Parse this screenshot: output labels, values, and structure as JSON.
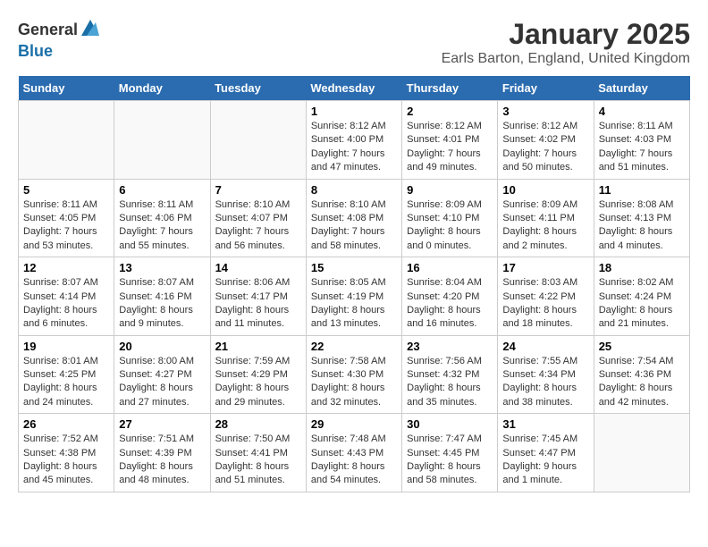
{
  "logo": {
    "general": "General",
    "blue": "Blue"
  },
  "title": "January 2025",
  "subtitle": "Earls Barton, England, United Kingdom",
  "headers": [
    "Sunday",
    "Monday",
    "Tuesday",
    "Wednesday",
    "Thursday",
    "Friday",
    "Saturday"
  ],
  "weeks": [
    [
      {
        "day": "",
        "content": ""
      },
      {
        "day": "",
        "content": ""
      },
      {
        "day": "",
        "content": ""
      },
      {
        "day": "1",
        "content": "Sunrise: 8:12 AM\nSunset: 4:00 PM\nDaylight: 7 hours\nand 47 minutes."
      },
      {
        "day": "2",
        "content": "Sunrise: 8:12 AM\nSunset: 4:01 PM\nDaylight: 7 hours\nand 49 minutes."
      },
      {
        "day": "3",
        "content": "Sunrise: 8:12 AM\nSunset: 4:02 PM\nDaylight: 7 hours\nand 50 minutes."
      },
      {
        "day": "4",
        "content": "Sunrise: 8:11 AM\nSunset: 4:03 PM\nDaylight: 7 hours\nand 51 minutes."
      }
    ],
    [
      {
        "day": "5",
        "content": "Sunrise: 8:11 AM\nSunset: 4:05 PM\nDaylight: 7 hours\nand 53 minutes."
      },
      {
        "day": "6",
        "content": "Sunrise: 8:11 AM\nSunset: 4:06 PM\nDaylight: 7 hours\nand 55 minutes."
      },
      {
        "day": "7",
        "content": "Sunrise: 8:10 AM\nSunset: 4:07 PM\nDaylight: 7 hours\nand 56 minutes."
      },
      {
        "day": "8",
        "content": "Sunrise: 8:10 AM\nSunset: 4:08 PM\nDaylight: 7 hours\nand 58 minutes."
      },
      {
        "day": "9",
        "content": "Sunrise: 8:09 AM\nSunset: 4:10 PM\nDaylight: 8 hours\nand 0 minutes."
      },
      {
        "day": "10",
        "content": "Sunrise: 8:09 AM\nSunset: 4:11 PM\nDaylight: 8 hours\nand 2 minutes."
      },
      {
        "day": "11",
        "content": "Sunrise: 8:08 AM\nSunset: 4:13 PM\nDaylight: 8 hours\nand 4 minutes."
      }
    ],
    [
      {
        "day": "12",
        "content": "Sunrise: 8:07 AM\nSunset: 4:14 PM\nDaylight: 8 hours\nand 6 minutes."
      },
      {
        "day": "13",
        "content": "Sunrise: 8:07 AM\nSunset: 4:16 PM\nDaylight: 8 hours\nand 9 minutes."
      },
      {
        "day": "14",
        "content": "Sunrise: 8:06 AM\nSunset: 4:17 PM\nDaylight: 8 hours\nand 11 minutes."
      },
      {
        "day": "15",
        "content": "Sunrise: 8:05 AM\nSunset: 4:19 PM\nDaylight: 8 hours\nand 13 minutes."
      },
      {
        "day": "16",
        "content": "Sunrise: 8:04 AM\nSunset: 4:20 PM\nDaylight: 8 hours\nand 16 minutes."
      },
      {
        "day": "17",
        "content": "Sunrise: 8:03 AM\nSunset: 4:22 PM\nDaylight: 8 hours\nand 18 minutes."
      },
      {
        "day": "18",
        "content": "Sunrise: 8:02 AM\nSunset: 4:24 PM\nDaylight: 8 hours\nand 21 minutes."
      }
    ],
    [
      {
        "day": "19",
        "content": "Sunrise: 8:01 AM\nSunset: 4:25 PM\nDaylight: 8 hours\nand 24 minutes."
      },
      {
        "day": "20",
        "content": "Sunrise: 8:00 AM\nSunset: 4:27 PM\nDaylight: 8 hours\nand 27 minutes."
      },
      {
        "day": "21",
        "content": "Sunrise: 7:59 AM\nSunset: 4:29 PM\nDaylight: 8 hours\nand 29 minutes."
      },
      {
        "day": "22",
        "content": "Sunrise: 7:58 AM\nSunset: 4:30 PM\nDaylight: 8 hours\nand 32 minutes."
      },
      {
        "day": "23",
        "content": "Sunrise: 7:56 AM\nSunset: 4:32 PM\nDaylight: 8 hours\nand 35 minutes."
      },
      {
        "day": "24",
        "content": "Sunrise: 7:55 AM\nSunset: 4:34 PM\nDaylight: 8 hours\nand 38 minutes."
      },
      {
        "day": "25",
        "content": "Sunrise: 7:54 AM\nSunset: 4:36 PM\nDaylight: 8 hours\nand 42 minutes."
      }
    ],
    [
      {
        "day": "26",
        "content": "Sunrise: 7:52 AM\nSunset: 4:38 PM\nDaylight: 8 hours\nand 45 minutes."
      },
      {
        "day": "27",
        "content": "Sunrise: 7:51 AM\nSunset: 4:39 PM\nDaylight: 8 hours\nand 48 minutes."
      },
      {
        "day": "28",
        "content": "Sunrise: 7:50 AM\nSunset: 4:41 PM\nDaylight: 8 hours\nand 51 minutes."
      },
      {
        "day": "29",
        "content": "Sunrise: 7:48 AM\nSunset: 4:43 PM\nDaylight: 8 hours\nand 54 minutes."
      },
      {
        "day": "30",
        "content": "Sunrise: 7:47 AM\nSunset: 4:45 PM\nDaylight: 8 hours\nand 58 minutes."
      },
      {
        "day": "31",
        "content": "Sunrise: 7:45 AM\nSunset: 4:47 PM\nDaylight: 9 hours\nand 1 minute."
      },
      {
        "day": "",
        "content": ""
      }
    ]
  ]
}
